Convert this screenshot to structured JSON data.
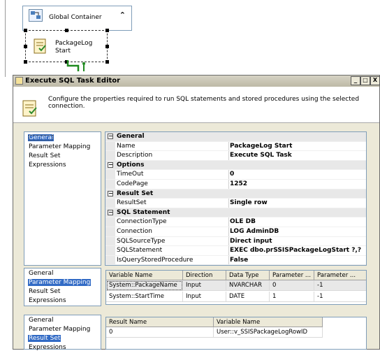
{
  "canvas": {
    "global_container_label": "Global Container",
    "task_label_line1": "PackageLog",
    "task_label_line2": "Start"
  },
  "dialog": {
    "title": "Execute SQL Task Editor",
    "description": "Configure the properties required to run SQL statements and stored procedures using the selected connection.",
    "window_buttons": {
      "minimize": "_",
      "maximize": "□",
      "close": "X"
    }
  },
  "nav": [
    "General",
    "Parameter Mapping",
    "Result Set",
    "Expressions"
  ],
  "property_grid": [
    {
      "type": "category",
      "label": "General"
    },
    {
      "type": "prop",
      "name": "Name",
      "value": "PackageLog Start"
    },
    {
      "type": "prop",
      "name": "Description",
      "value": "Execute SQL Task"
    },
    {
      "type": "category",
      "label": "Options"
    },
    {
      "type": "prop",
      "name": "TimeOut",
      "value": "0"
    },
    {
      "type": "prop",
      "name": "CodePage",
      "value": "1252"
    },
    {
      "type": "category",
      "label": "Result Set"
    },
    {
      "type": "prop",
      "name": "ResultSet",
      "value": "Single row"
    },
    {
      "type": "category",
      "label": "SQL Statement"
    },
    {
      "type": "prop",
      "name": "ConnectionType",
      "value": "OLE DB"
    },
    {
      "type": "prop",
      "name": "Connection",
      "value": "LOG AdminDB"
    },
    {
      "type": "prop",
      "name": "SQLSourceType",
      "value": "Direct input"
    },
    {
      "type": "prop",
      "name": "SQLStatement",
      "value": "EXEC dbo.prSSISPackageLogStart ?,?"
    },
    {
      "type": "prop",
      "name": "IsQueryStoredProcedure",
      "value": "False"
    }
  ],
  "parameter_mapping": {
    "headers": [
      "Variable Name",
      "Direction",
      "Data Type",
      "Parameter ...",
      "Parameter ..."
    ],
    "rows": [
      [
        "System::PackageName",
        "Input",
        "NVARCHAR",
        "0",
        "-1"
      ],
      [
        "System::StartTime",
        "Input",
        "DATE",
        "1",
        "-1"
      ]
    ]
  },
  "result_set": {
    "headers": [
      "Result Name",
      "Variable Name"
    ],
    "rows": [
      [
        "0",
        "User::v_SSISPackageLogRowID"
      ]
    ]
  },
  "colors": {
    "selection": "#316ac5",
    "dialog_bg": "#ece9d8"
  },
  "icons": [
    "sequence-container-icon",
    "execute-sql-task-icon",
    "collapse-chevron-icon",
    "precedence-connector"
  ]
}
